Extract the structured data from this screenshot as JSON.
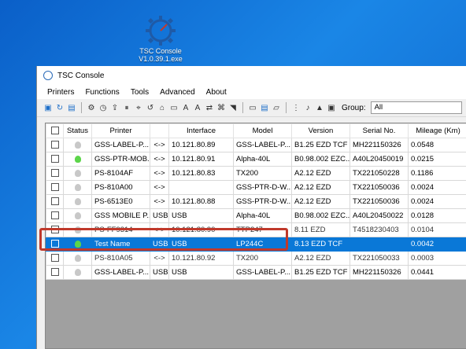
{
  "desktop": {
    "icon_label_line1": "TSC Console",
    "icon_label_line2": "V1.0.39.1.exe"
  },
  "window": {
    "title": "TSC Console"
  },
  "menu": [
    "Printers",
    "Functions",
    "Tools",
    "Advanced",
    "About"
  ],
  "toolbar": {
    "group_label": "Group:",
    "group_value": "All"
  },
  "columns": [
    "",
    "Status",
    "Printer",
    "",
    "Interface",
    "Model",
    "Version",
    "Serial No.",
    "Mileage (Km)"
  ],
  "rows": [
    {
      "status": "off",
      "printer": "GSS-LABEL-P...",
      "conn": "<->",
      "interface": "10.121.80.89",
      "model": "GSS-LABEL-P...",
      "version": "B1.25 EZD TCF",
      "serial": "MH221150326",
      "mileage": "0.0548"
    },
    {
      "status": "on",
      "printer": "GSS-PTR-MOB...",
      "conn": "<->",
      "interface": "10.121.80.91",
      "model": "Alpha-40L",
      "version": "B0.98.002 EZC...",
      "serial": "A40L20450019",
      "mileage": "0.0215"
    },
    {
      "status": "off",
      "printer": "PS-8104AF",
      "conn": "<->",
      "interface": "10.121.80.83",
      "model": "TX200",
      "version": "A2.12 EZD",
      "serial": "TX221050228",
      "mileage": "0.1186"
    },
    {
      "status": "off",
      "printer": "PS-810A00",
      "conn": "<->",
      "interface": "",
      "model": "GSS-PTR-D-W...",
      "version": "A2.12 EZD",
      "serial": "TX221050036",
      "mileage": "0.0024"
    },
    {
      "status": "off",
      "printer": "PS-6513E0",
      "conn": "<->",
      "interface": "10.121.80.88",
      "model": "GSS-PTR-D-W...",
      "version": "A2.12 EZD",
      "serial": "TX221050036",
      "mileage": "0.0024"
    },
    {
      "status": "off",
      "printer": "GSS MOBILE P...",
      "conn": "USB",
      "interface": "USB",
      "model": "Alpha-40L",
      "version": "B0.98.002 EZC...",
      "serial": "A40L20450022",
      "mileage": "0.0128"
    },
    {
      "status": "off",
      "printer": "PS-FF9314",
      "conn": "<->",
      "interface": "10.121.80.90",
      "model": "TTP247",
      "version": "8.11 EZD",
      "serial": "T4518230403",
      "mileage": "0.0104",
      "partial": true
    },
    {
      "status": "on",
      "printer": "Test Name",
      "conn": "USB",
      "interface": "USB",
      "model": "LP244C",
      "version": "8.13 EZD TCF",
      "serial": "",
      "mileage": "0.0042",
      "selected": true
    },
    {
      "status": "off",
      "printer": "PS-810A05",
      "conn": "<->",
      "interface": "10.121.80.92",
      "model": "TX200",
      "version": "A2.12 EZD",
      "serial": "TX221050033",
      "mileage": "0.0003",
      "partial": true
    },
    {
      "status": "off",
      "printer": "GSS-LABEL-P...",
      "conn": "USB",
      "interface": "USB",
      "model": "GSS-LABEL-P...",
      "version": "B1.25 EZD TCF",
      "serial": "MH221150326",
      "mileage": "0.0441"
    }
  ]
}
